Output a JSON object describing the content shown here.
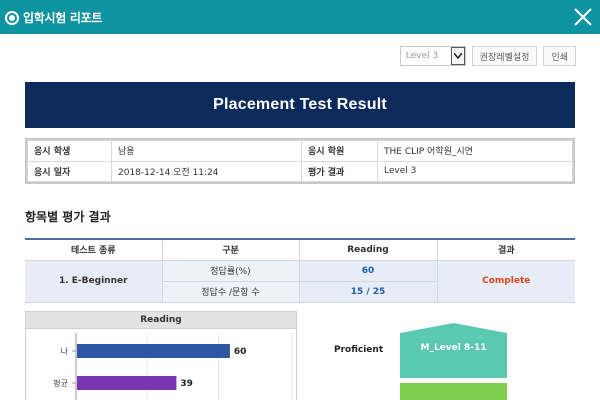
{
  "window": {
    "title": "입학시험 리포트"
  },
  "toolbar": {
    "level_selected": "Level 3",
    "recommend_button": "권장레벨설정",
    "print_button": "인쇄"
  },
  "banner": {
    "title": "Placement Test Result"
  },
  "info": {
    "student_label": "응시 학생",
    "student_value": "남용",
    "academy_label": "응시 학원",
    "academy_value": "THE CLIP 어학원_시연",
    "date_label": "응시 일자",
    "date_value": "2018-12-14 오전 11:24",
    "result_label": "평가 결과",
    "result_value": "Level 3"
  },
  "section": {
    "title": "항목별 평가 결과"
  },
  "result_table": {
    "headers": [
      "테스트 종류",
      "구분",
      "Reading",
      "결과"
    ],
    "test_name": "1. E-Beginner",
    "row1_label": "정답률(%)",
    "row1_value": "60",
    "row2_label": "정답수 /문항 수",
    "row2_value": "15 / 25",
    "status": "Complete"
  },
  "chart_data": {
    "type": "bar",
    "title": "Reading",
    "categories": [
      "나",
      "평균"
    ],
    "values": [
      60,
      39
    ],
    "colors": [
      "#2e57a3",
      "#7a35b0"
    ],
    "xlim": [
      0,
      100
    ]
  },
  "level_panel": {
    "label": "Proficient",
    "house_label": "M_Level 8-11",
    "house_color": "#5bc8b0",
    "block_color": "#7fcf4f"
  }
}
